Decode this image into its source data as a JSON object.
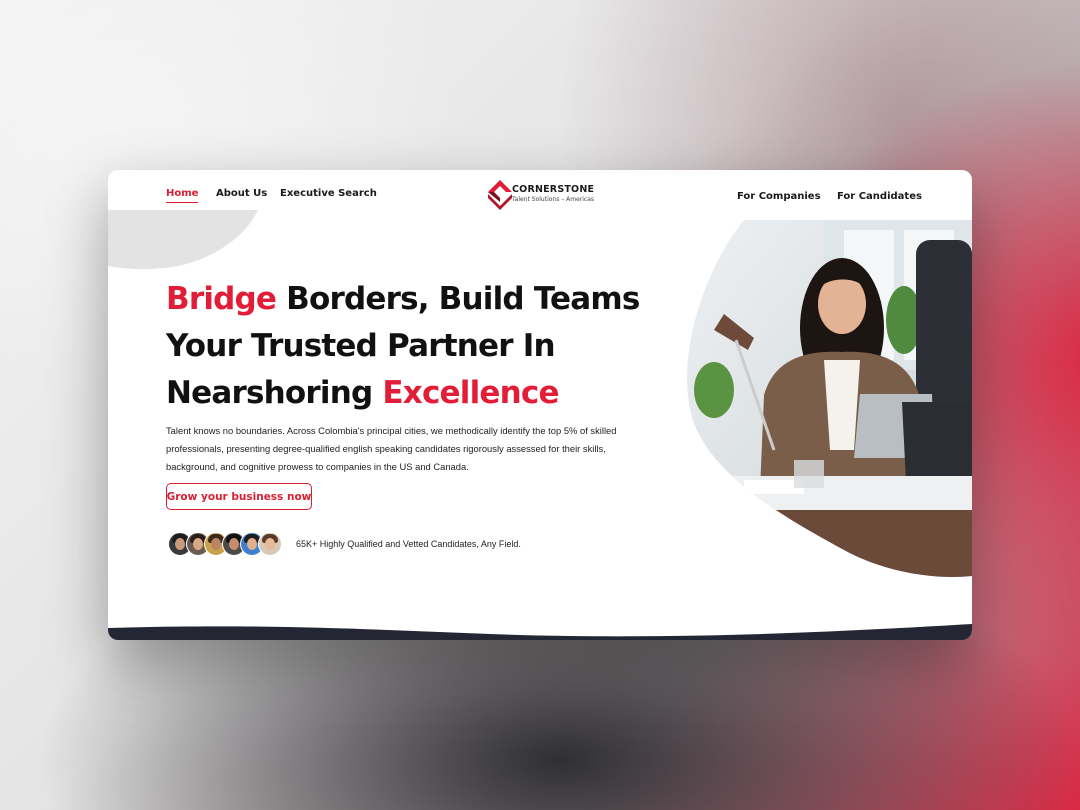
{
  "nav": {
    "left": [
      {
        "label": "Home",
        "active": true
      },
      {
        "label": "About Us",
        "active": false
      },
      {
        "label": "Executive Search",
        "active": false
      }
    ],
    "right": [
      {
        "label": "For Companies"
      },
      {
        "label": "For Candidates"
      }
    ],
    "logo": {
      "title": "CORNERSTONE",
      "subtitle": "Talent Solutions – Americas"
    }
  },
  "hero": {
    "headline_line1_accent": "Bridge",
    "headline_line1_rest": " Borders, Build Teams",
    "headline_line2": "Your Trusted Partner In",
    "headline_line3_start": "Nearshoring ",
    "headline_line3_accent": "Excellence",
    "description": "Talent knows no boundaries. Across Colombia's principal cities, we methodically identify the top 5% of skilled professionals, presenting degree-qualified english speaking candidates rigorously assessed for their skills, background, and cognitive prowess to companies in the US and Canada.",
    "cta_label": "Grow your business now",
    "candidates_stat": "65K+ Highly Qualified and Vetted Candidates, Any Field.",
    "avatar_count": 6
  },
  "colors": {
    "accent": "#e11d37",
    "text": "#111111",
    "backdrop_red": "#d82844"
  },
  "icons": [
    "cornerstone-logo-icon",
    "candidate-avatar-icon"
  ]
}
